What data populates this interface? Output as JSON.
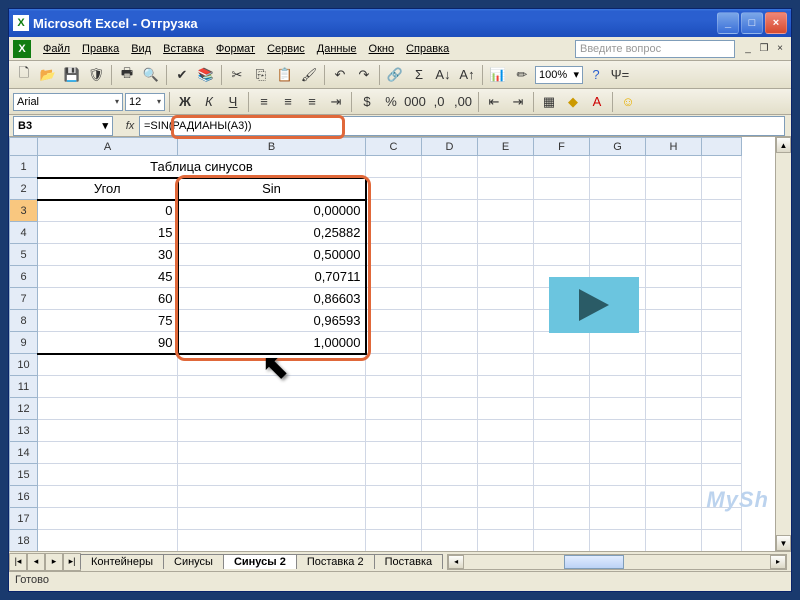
{
  "titlebar": {
    "title": "Microsoft Excel - Отгрузка"
  },
  "menu": {
    "items": [
      "Файл",
      "Правка",
      "Вид",
      "Вставка",
      "Формат",
      "Сервис",
      "Данные",
      "Окно",
      "Справка"
    ],
    "question_placeholder": "Введите вопрос"
  },
  "toolbar": {
    "zoom": "100%"
  },
  "format": {
    "font": "Arial",
    "size": "12"
  },
  "namebar": {
    "cell_ref": "B3",
    "formula": "=SIN(РАДИАНЫ(A3))",
    "fx": "fx"
  },
  "columns": [
    "A",
    "B",
    "C",
    "D",
    "E",
    "F",
    "G",
    "H"
  ],
  "rows": [
    "1",
    "2",
    "3",
    "4",
    "5",
    "6",
    "7",
    "8",
    "9",
    "10",
    "11",
    "12",
    "13",
    "14",
    "15",
    "16",
    "17",
    "18"
  ],
  "cells": {
    "title": "Таблица синусов",
    "h_angle": "Угол",
    "h_sin": "Sin",
    "data": [
      {
        "a": "0",
        "b": "0,00000"
      },
      {
        "a": "15",
        "b": "0,25882"
      },
      {
        "a": "30",
        "b": "0,50000"
      },
      {
        "a": "45",
        "b": "0,70711"
      },
      {
        "a": "60",
        "b": "0,86603"
      },
      {
        "a": "75",
        "b": "0,96593"
      },
      {
        "a": "90",
        "b": "1,00000"
      }
    ]
  },
  "tabs": {
    "items": [
      "Контейнеры",
      "Синусы",
      "Синусы 2",
      "Поставка 2",
      "Поставка"
    ],
    "active": 2
  },
  "status": {
    "text": "Готово"
  },
  "watermark": "MySh"
}
